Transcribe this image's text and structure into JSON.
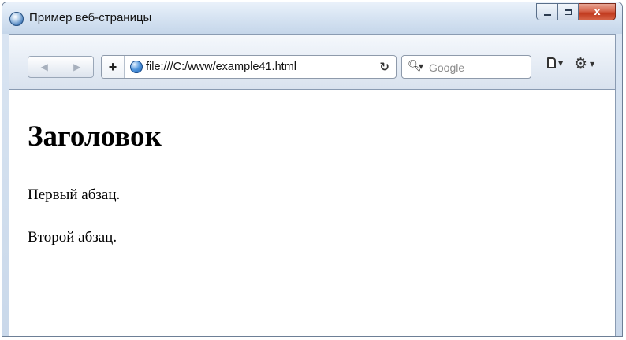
{
  "window": {
    "title": "Пример веб-страницы",
    "close_glyph": "x"
  },
  "toolbar": {
    "back_glyph": "◀",
    "forward_glyph": "▶",
    "add_glyph": "+",
    "url": "file:///C:/www/example41.html",
    "reload_glyph": "↻",
    "search_placeholder": "Google",
    "search_icon": "search-icon",
    "page_menu_icon": "page-icon",
    "tools_menu_icon": "gear-icon",
    "gear_glyph": "⚙"
  },
  "page": {
    "heading": "Заголовок",
    "paragraphs": [
      "Первый абзац.",
      "Второй абзац."
    ]
  },
  "colors": {
    "close_button": "#c13a1e",
    "chrome": "#d6e3f2",
    "page_bg": "#ffffff"
  }
}
